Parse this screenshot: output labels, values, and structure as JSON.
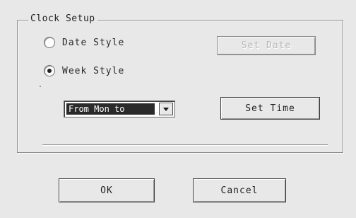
{
  "group": {
    "title": "Clock Setup"
  },
  "radios": {
    "date_style": {
      "label": "Date Style",
      "checked": false
    },
    "week_style": {
      "label": "Week Style",
      "checked": true
    }
  },
  "buttons": {
    "set_date": "Set Date",
    "set_time": "Set Time",
    "ok": "OK",
    "cancel": "Cancel"
  },
  "week_range": {
    "selected": "From Mon to"
  },
  "icons": {
    "dropdown": "chevron-down-icon"
  },
  "colors": {
    "background": "#e8e8e8",
    "selection": "#2a2a2a"
  }
}
